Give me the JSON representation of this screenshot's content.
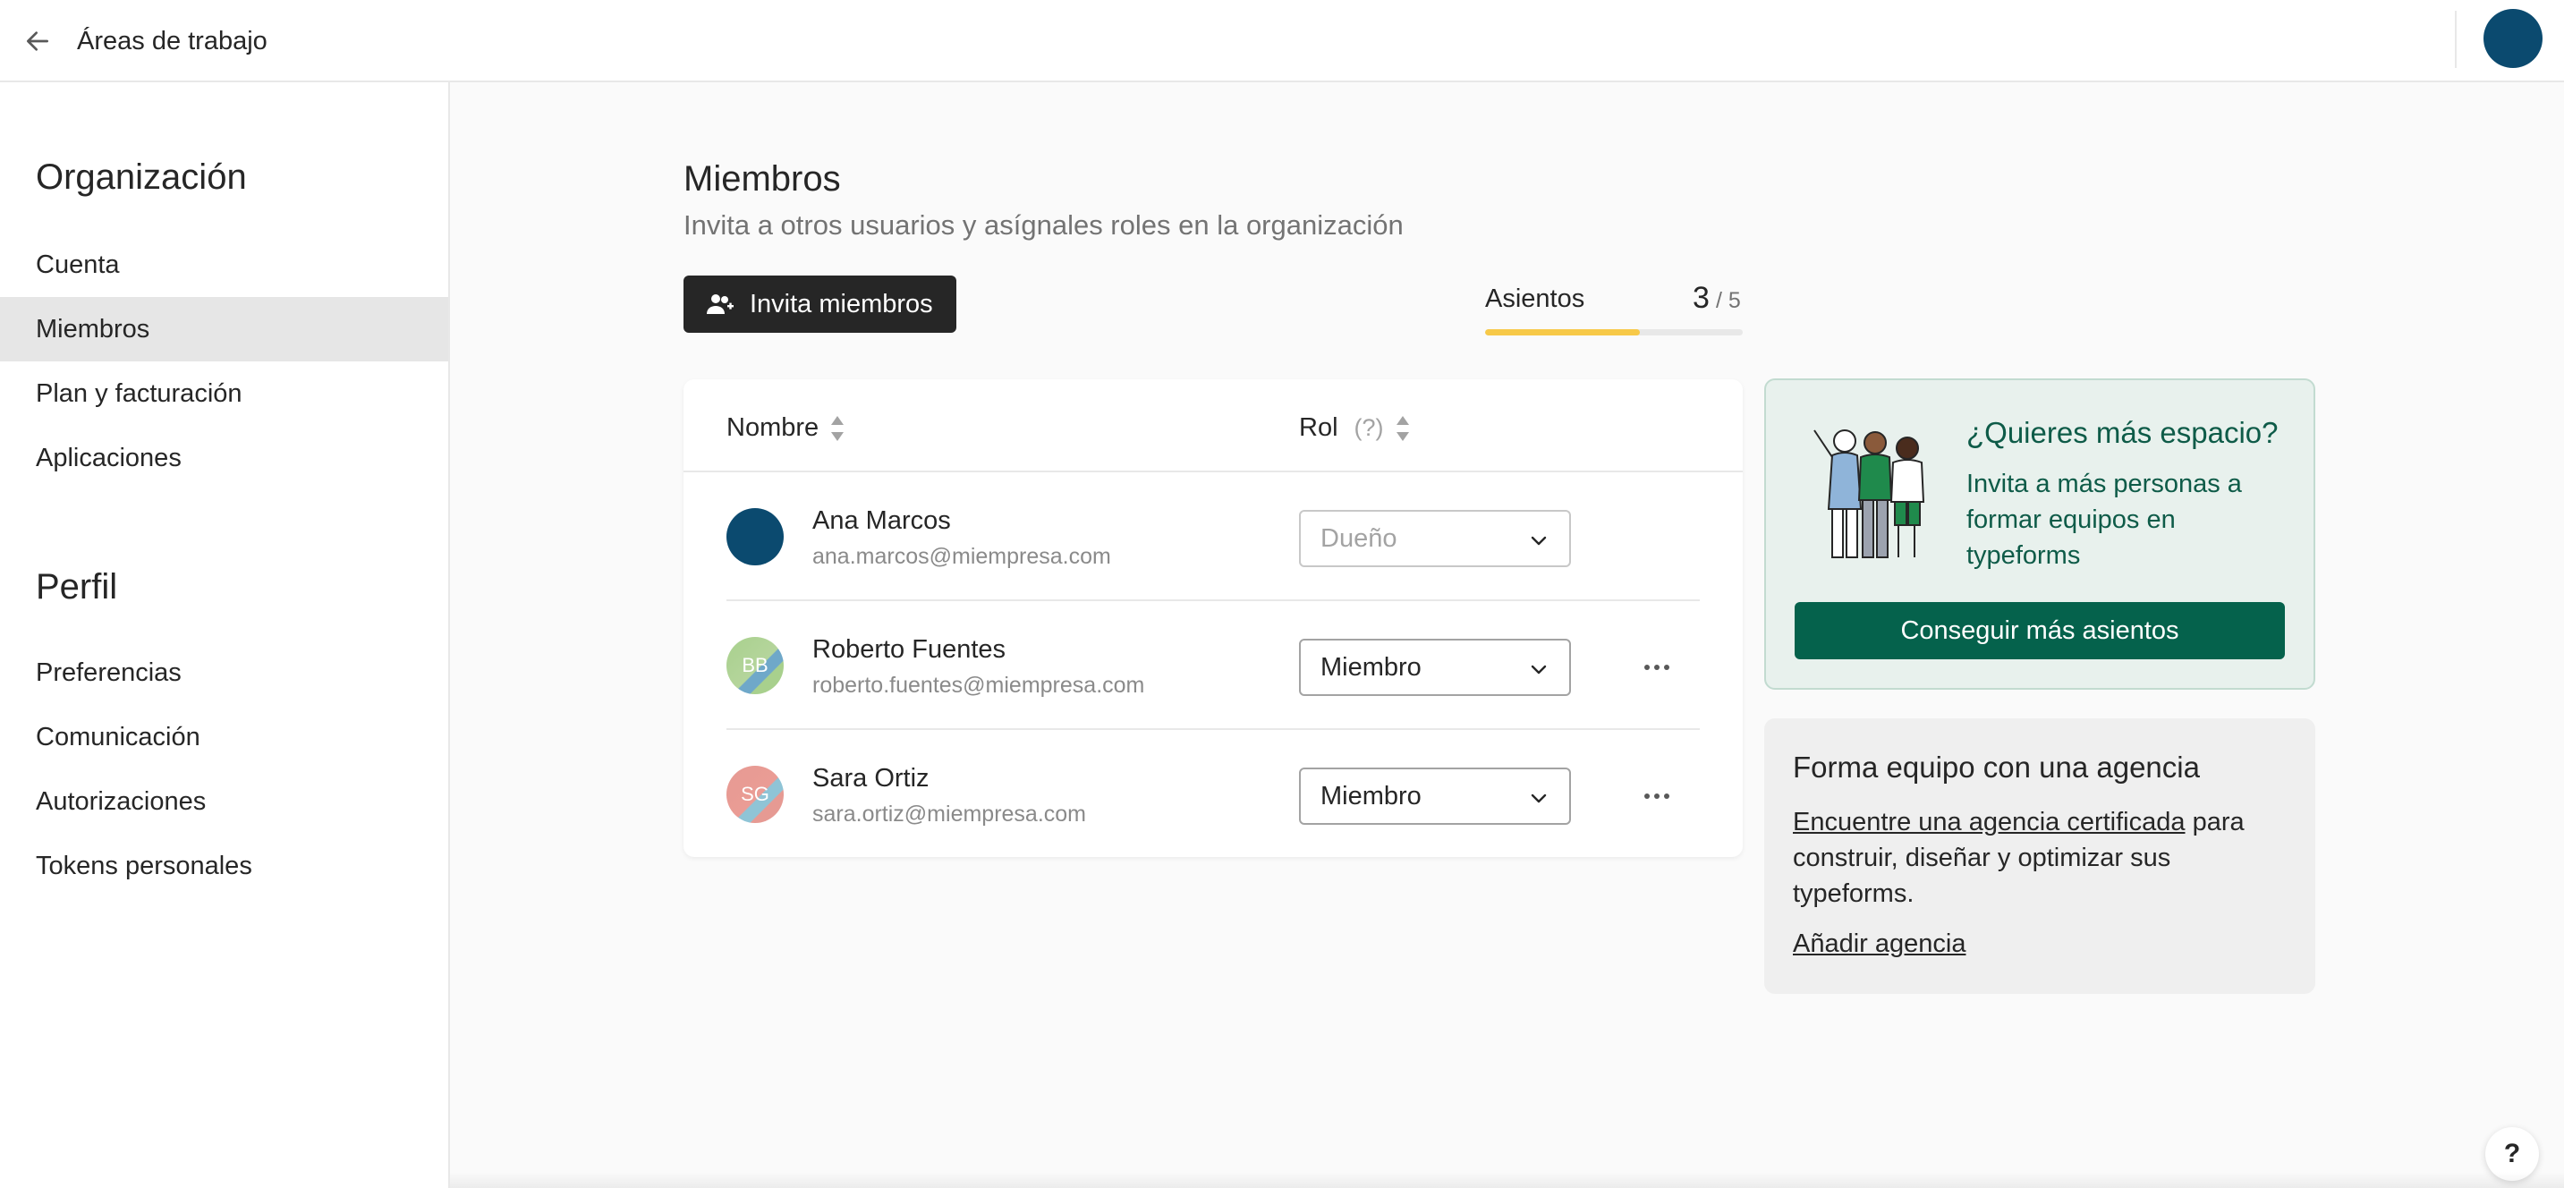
{
  "header": {
    "title": "Áreas de trabajo"
  },
  "sidebar": {
    "sections": [
      {
        "title": "Organización",
        "items": [
          {
            "label": "Cuenta"
          },
          {
            "label": "Miembros"
          },
          {
            "label": "Plan y facturación"
          },
          {
            "label": "Aplicaciones"
          }
        ]
      },
      {
        "title": "Perfil",
        "items": [
          {
            "label": "Preferencias"
          },
          {
            "label": "Comunicación"
          },
          {
            "label": "Autorizaciones"
          },
          {
            "label": "Tokens personales"
          }
        ]
      }
    ],
    "active_item": "Miembros"
  },
  "main": {
    "title": "Miembros",
    "subtitle": "Invita a otros usuarios y asígnales roles en la organización",
    "invite_label": "Invita miembros",
    "seats": {
      "label": "Asientos",
      "used": "3",
      "total": "/ 5",
      "fill_fraction": 0.6
    },
    "table": {
      "col_name": "Nombre",
      "col_role": "Rol",
      "role_help": "(?)",
      "members": [
        {
          "name": "Ana Marcos",
          "email": "ana.marcos@miempresa.com",
          "initials": "",
          "role": "Dueño",
          "editable": false
        },
        {
          "name": "Roberto Fuentes",
          "email": "roberto.fuentes@miempresa.com",
          "initials": "BB",
          "role": "Miembro",
          "editable": true
        },
        {
          "name": "Sara Ortiz",
          "email": "sara.ortiz@miempresa.com",
          "initials": "SG",
          "role": "Miembro",
          "editable": true
        }
      ]
    }
  },
  "promo": {
    "title": "¿Quieres más espacio?",
    "text": "Invita a más personas a formar equipos en typeforms",
    "button": "Conseguir más asientos"
  },
  "agency": {
    "title": "Forma equipo con una agencia",
    "link_text": "Encuentre una agencia certificada",
    "text_rest": " para construir, diseñar y optimizar sus typeforms.",
    "add_link": "Añadir agencia"
  },
  "help": {
    "label": "?"
  },
  "colors": {
    "primary_dark": "#262626",
    "promo_green": "#05624c",
    "seats_yellow": "#f7c948",
    "avatar_blue": "#0b4a6f"
  }
}
